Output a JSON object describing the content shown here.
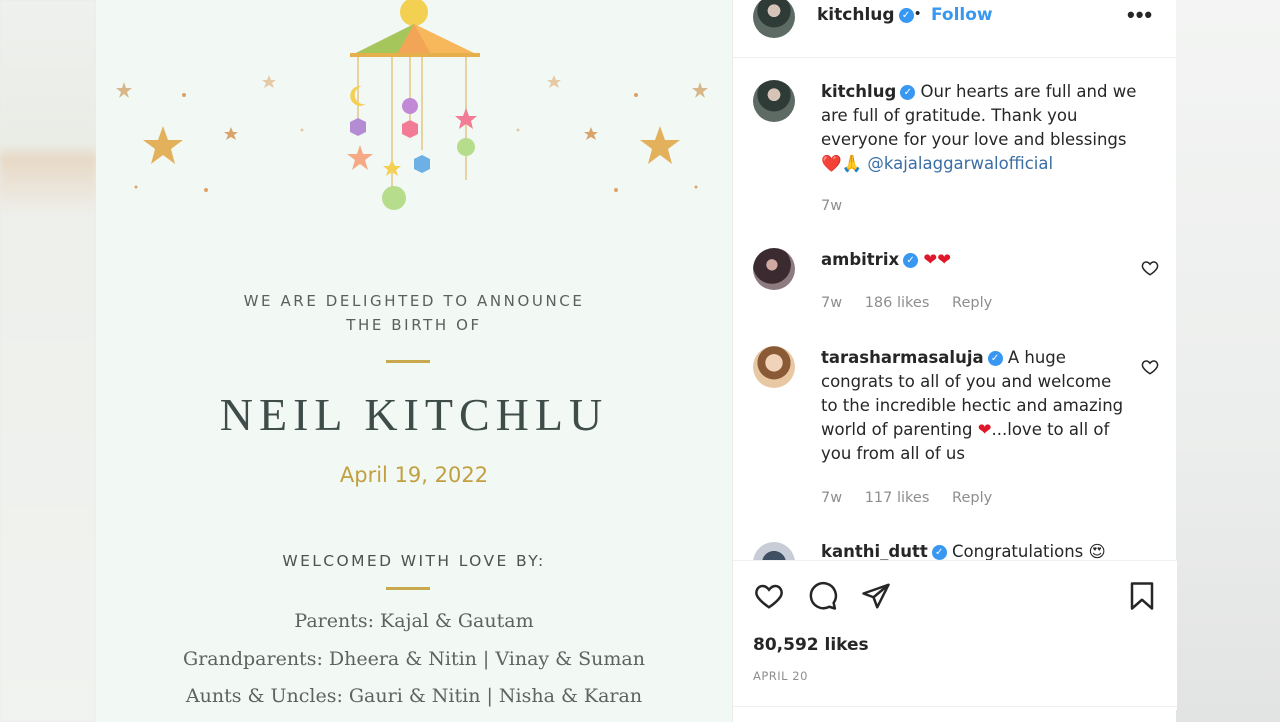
{
  "invitation": {
    "announce_line1": "WE ARE DELIGHTED TO ANNOUNCE",
    "announce_line2": "THE BIRTH OF",
    "baby_name": "NEIL KITCHLU",
    "birth_date": "April 19, 2022",
    "welcomed_heading": "WELCOMED WITH LOVE BY:",
    "parents": "Parents: Kajal & Gautam",
    "grandparents": "Grandparents: Dheera & Nitin | Vinay & Suman",
    "aunts_uncles": "Aunts & Uncles: Gauri & Nitin | Nisha & Karan"
  },
  "post": {
    "author": "kitchlug",
    "follow_label": "Follow",
    "separator": "•",
    "more_label": "•••",
    "caption": {
      "username": "kitchlug",
      "text": "Our hearts are full and we are full of gratitude. Thank you everyone for your love and blessings",
      "emojis": "❤️🙏",
      "mention": "@kajalaggarwalofficial",
      "time": "7w"
    },
    "comments": [
      {
        "username": "ambitrix",
        "text": "❤❤",
        "time": "7w",
        "likes": "186 likes",
        "reply": "Reply"
      },
      {
        "username": "tarasharmasaluja",
        "text_before": "A huge congrats to all of you and welcome to the incredible hectic and amazing world of parenting",
        "heart": "❤",
        "text_after": "...love to all of you from all of us",
        "time": "7w",
        "likes": "117 likes",
        "reply": "Reply"
      },
      {
        "username": "kanthi_dutt",
        "text": "Congratulations",
        "emoji": "😍"
      }
    ],
    "likes_count": "80,592 likes",
    "date": "APRIL 20"
  },
  "icons": {
    "heart": "heart-icon",
    "comment": "comment-icon",
    "share": "share-icon",
    "save": "bookmark-icon",
    "verified": "verified-badge-icon"
  },
  "colors": {
    "accent_blue": "#3897f0",
    "gold": "#c9a94d",
    "invite_bg": "#f2f8f3",
    "heart_red": "#e0162b"
  }
}
